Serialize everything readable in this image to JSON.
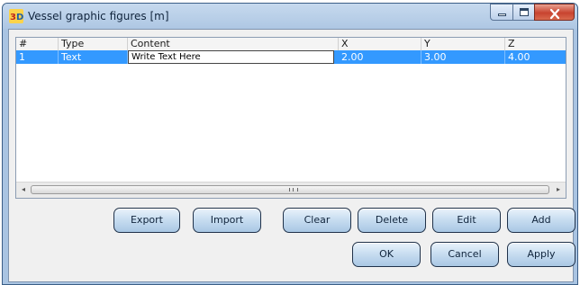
{
  "window": {
    "title": "Vessel graphic figures [m]"
  },
  "grid": {
    "columns": [
      "#",
      "Type",
      "Content",
      "X",
      "Y",
      "Z"
    ],
    "rows": [
      {
        "num": "1",
        "type": "Text",
        "content": "Write Text Here",
        "x": "2.00",
        "y": "3.00",
        "z": "4.00"
      }
    ]
  },
  "scrollbar": {
    "left_arrow": "◂",
    "right_arrow": "▸"
  },
  "buttons": {
    "export": "Export",
    "import": "Import",
    "clear": "Clear",
    "delete": "Delete",
    "edit": "Edit",
    "add": "Add",
    "ok": "OK",
    "cancel": "Cancel",
    "apply": "Apply"
  },
  "colors": {
    "selection": "#3399ff",
    "client_bg": "#f0f0f0",
    "close_button": "#c8432f"
  },
  "icons": {
    "app": "3d-app-icon",
    "minimize": "minimize-icon",
    "maximize": "maximize-icon",
    "close": "close-icon"
  }
}
